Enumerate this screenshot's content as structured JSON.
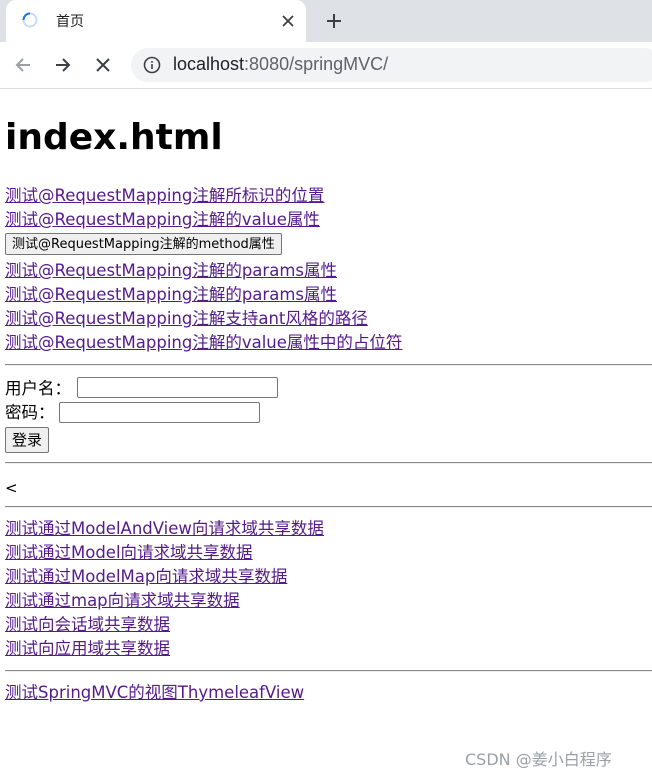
{
  "browser": {
    "tab_title": "首页",
    "url_host": "localhost",
    "url_rest": ":8080/springMVC/"
  },
  "page": {
    "heading": "index.html",
    "links_group1": [
      "测试@RequestMapping注解所标识的位置",
      "测试@RequestMapping注解的value属性"
    ],
    "method_button": "测试@RequestMapping注解的method属性",
    "links_group2": [
      "测试@RequestMapping注解的params属性",
      "测试@RequestMapping注解的params属性",
      "测试@RequestMapping注解支持ant风格的路径",
      "测试@RequestMapping注解的value属性中的占位符"
    ],
    "login": {
      "username_label": "用户名：",
      "password_label": "密码：",
      "submit_label": "登录"
    },
    "stray_text": "<",
    "links_group3": [
      "测试通过ModelAndView向请求域共享数据",
      "测试通过Model向请求域共享数据",
      "测试通过ModelMap向请求域共享数据",
      "测试通过map向请求域共享数据",
      "测试向会话域共享数据",
      "测试向应用域共享数据"
    ],
    "links_group4": [
      "测试SpringMVC的视图ThymeleafView"
    ]
  },
  "watermark": "CSDN @姜小白程序",
  "colors": {
    "link": "#551a8b",
    "tabstrip": "#dee1e6",
    "omnibox": "#f1f3f4"
  }
}
